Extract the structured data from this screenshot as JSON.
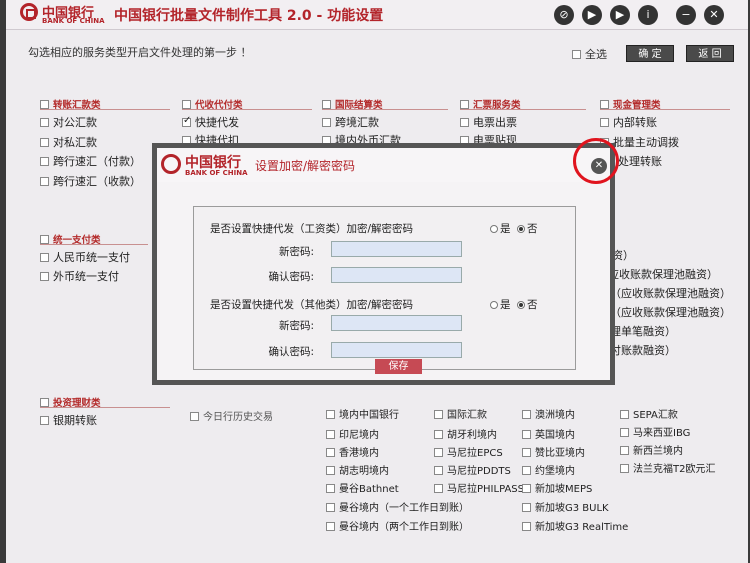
{
  "app": {
    "logo_cn": "中国银行",
    "logo_en": "BANK OF CHINA",
    "title": "中国银行批量文件制作工具 2.0 - 功能设置"
  },
  "toolbar": {
    "icons": [
      "link-icon",
      "play-icon",
      "next-icon",
      "info-icon",
      "minimize-icon",
      "close-icon"
    ],
    "icon_glyphs": [
      "⊘",
      "▶",
      "▶",
      "i",
      "−",
      "✕"
    ]
  },
  "header": {
    "instruction": "勾选相应的服务类型开启文件处理的第一步 ！",
    "select_all": "全选",
    "confirm": "确 定",
    "back": "返 回"
  },
  "sections": {
    "transfer": {
      "title": "转账汇款类",
      "items": [
        "对公汇款",
        "对私汇款",
        "跨行速汇（付款）",
        "跨行速汇（收款）"
      ]
    },
    "agency": {
      "title": "代收代付类",
      "items": [
        "快捷代发",
        "快捷代扣"
      ]
    },
    "intl": {
      "title": "国际结算类",
      "items": [
        "跨境汇款",
        "境内外币汇款"
      ]
    },
    "draft": {
      "title": "汇票服务类",
      "items": [
        "电票出票",
        "电票贴现"
      ]
    },
    "cash": {
      "title": "现金管理类",
      "items": [
        "内部转账",
        "批量主动调拨",
        "处理转账"
      ]
    },
    "unified": {
      "title": "统一支付类",
      "items": [
        "人民币统一支付",
        "外币统一支付"
      ]
    },
    "invest": {
      "title": "投资理财类",
      "items": [
        "银期转账"
      ]
    },
    "right_partial": [
      "资）",
      "应收账款保理池融资）",
      "（应收账款保理池融资）",
      "（应收账款保理池融资）",
      "理单笔融资）",
      "付账款融资）"
    ],
    "bottom_col1": [
      "境内中国银行",
      "印尼境内",
      "香港境内",
      "胡志明境内",
      "曼谷Bathnet",
      "曼谷境内（一个工作日到账）",
      "曼谷境内（两个工作日到账）"
    ],
    "bottom_col1_extra": "今日行历史交易",
    "bottom_col2": [
      "国际汇款",
      "胡牙利境内",
      "马尼拉EPCS",
      "马尼拉PDDTS",
      "马尼拉PHILPASS"
    ],
    "bottom_col3": [
      "澳洲境内",
      "英国境内",
      "赞比亚境内",
      "约堡境内",
      "新加坡MEPS",
      "新加坡G3 BULK",
      "新加坡G3 RealTime"
    ],
    "bottom_col4": [
      "SEPA汇款",
      "马来西亚IBG",
      "新西兰境内",
      "法兰克福T2欧元汇"
    ]
  },
  "dialog": {
    "logo_cn": "中国银行",
    "logo_en": "BANK OF CHINA",
    "title": "设置加密/解密密码",
    "close_glyph": "✕",
    "q1": "是否设置快捷代发（工资类）加密/解密密码",
    "q2": "是否设置快捷代发（其他类）加密/解密密码",
    "yes": "是",
    "no": "否",
    "new_pwd": "新密码:",
    "confirm_pwd": "确认密码:",
    "save": "保存"
  }
}
